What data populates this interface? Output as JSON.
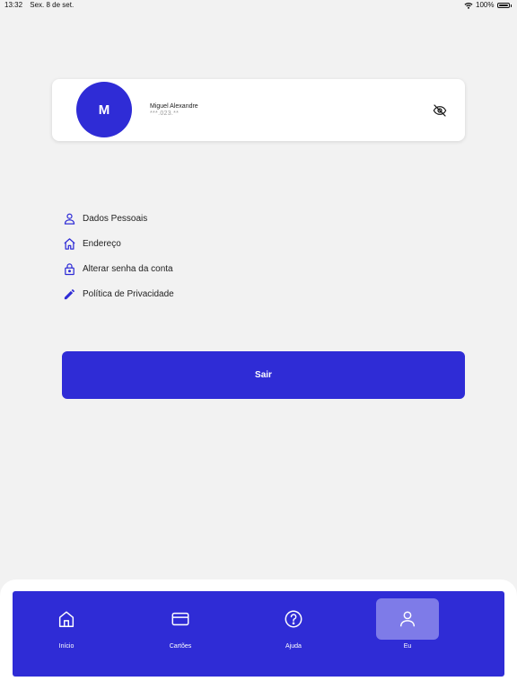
{
  "status_bar": {
    "time": "13:32",
    "date": "Sex. 8 de set.",
    "battery": "100%"
  },
  "profile": {
    "initial": "M",
    "name": "Miguel Alexandre",
    "document_masked": "***.023.**",
    "visibility_icon": "eye-off-icon"
  },
  "menu": {
    "items": [
      {
        "label": "Dados Pessoais",
        "icon": "person-icon"
      },
      {
        "label": "Endereço",
        "icon": "home-icon"
      },
      {
        "label": "Alterar senha da conta",
        "icon": "lock-icon"
      },
      {
        "label": "Política de Privacidade",
        "icon": "pencil-icon"
      }
    ]
  },
  "logout": {
    "label": "Sair"
  },
  "tabs": [
    {
      "label": "Início",
      "icon": "home-icon",
      "active": false
    },
    {
      "label": "Cartões",
      "icon": "card-icon",
      "active": false
    },
    {
      "label": "Ajuda",
      "icon": "help-icon",
      "active": false
    },
    {
      "label": "Eu",
      "icon": "user-icon",
      "active": true
    }
  ],
  "colors": {
    "accent": "#2f2cd6",
    "active_tab": "#7e7be8",
    "background": "#f2f2f2"
  }
}
